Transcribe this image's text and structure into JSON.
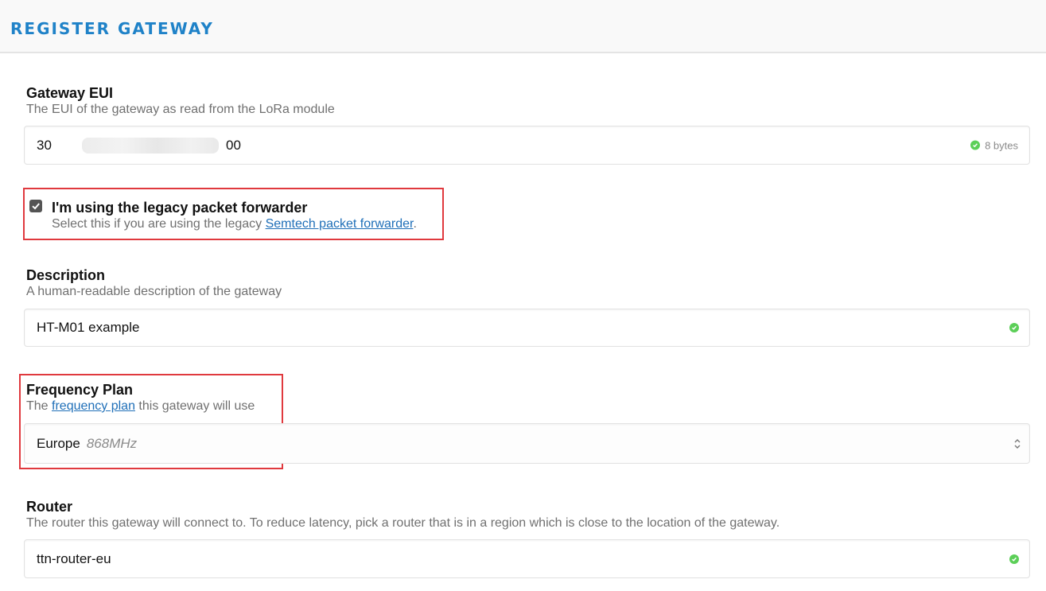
{
  "header": {
    "title": "REGISTER GATEWAY"
  },
  "gateway_eui": {
    "label": "Gateway EUI",
    "help": "The EUI of the gateway as read from the LoRa module",
    "value_start": "30",
    "value_end": "00",
    "size_hint": "8 bytes"
  },
  "legacy": {
    "checked": true,
    "label": "I'm using the legacy packet forwarder",
    "help_prefix": "Select this if you are using the legacy ",
    "help_link": "Semtech packet forwarder",
    "help_suffix": "."
  },
  "description": {
    "label": "Description",
    "help": "A human-readable description of the gateway",
    "value": "HT-M01 example"
  },
  "frequency_plan": {
    "label": "Frequency Plan",
    "help_prefix": "The ",
    "help_link": "frequency plan",
    "help_suffix": " this gateway will use",
    "selected": "Europe",
    "selected_detail": "868MHz"
  },
  "router": {
    "label": "Router",
    "help": "The router this gateway will connect to. To reduce latency, pick a router that is in a region which is close to the location of the gateway.",
    "value": "ttn-router-eu"
  },
  "colors": {
    "accent": "#1f82c8",
    "link": "#1f6fb8",
    "highlight": "#e0393e",
    "valid": "#5ccf58"
  },
  "icons": {
    "valid": "check-circle-icon",
    "checkbox": "checkmark-icon",
    "select": "up-down-chevron-icon"
  }
}
